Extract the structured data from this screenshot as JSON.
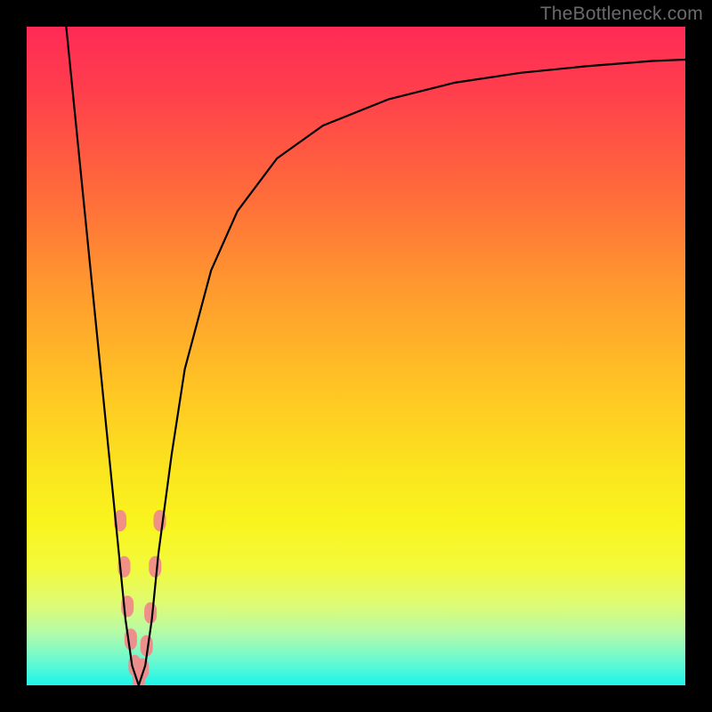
{
  "watermark": "TheBottleneck.com",
  "chart_data": {
    "type": "line",
    "title": "",
    "xlabel": "",
    "ylabel": "",
    "xlim": [
      0,
      100
    ],
    "ylim": [
      0,
      100
    ],
    "series": [
      {
        "name": "bottleneck-curve",
        "x": [
          6,
          8,
          10,
          12,
          14,
          15,
          16,
          17,
          18,
          19,
          20,
          22,
          24,
          28,
          32,
          38,
          45,
          55,
          65,
          75,
          85,
          95,
          100
        ],
        "y": [
          100,
          80,
          60,
          40,
          20,
          10,
          3,
          0,
          3,
          10,
          20,
          35,
          48,
          63,
          72,
          80,
          85,
          89,
          91.5,
          93,
          94,
          94.8,
          95
        ]
      }
    ],
    "markers": {
      "name": "highlight-points",
      "color": "#f08a8a",
      "points": [
        {
          "x": 14.2,
          "y": 25
        },
        {
          "x": 14.8,
          "y": 18
        },
        {
          "x": 15.3,
          "y": 12
        },
        {
          "x": 15.8,
          "y": 7
        },
        {
          "x": 16.4,
          "y": 3
        },
        {
          "x": 17.0,
          "y": 0.8
        },
        {
          "x": 17.6,
          "y": 2.5
        },
        {
          "x": 18.2,
          "y": 6
        },
        {
          "x": 18.8,
          "y": 11
        },
        {
          "x": 19.5,
          "y": 18
        },
        {
          "x": 20.2,
          "y": 25
        }
      ]
    },
    "gradient_stops": [
      {
        "pos": 0,
        "color": "#ff2a56"
      },
      {
        "pos": 25,
        "color": "#ff6a3b"
      },
      {
        "pos": 55,
        "color": "#ffc524"
      },
      {
        "pos": 78,
        "color": "#f9f41e"
      },
      {
        "pos": 100,
        "color": "#20f5e8"
      }
    ]
  }
}
